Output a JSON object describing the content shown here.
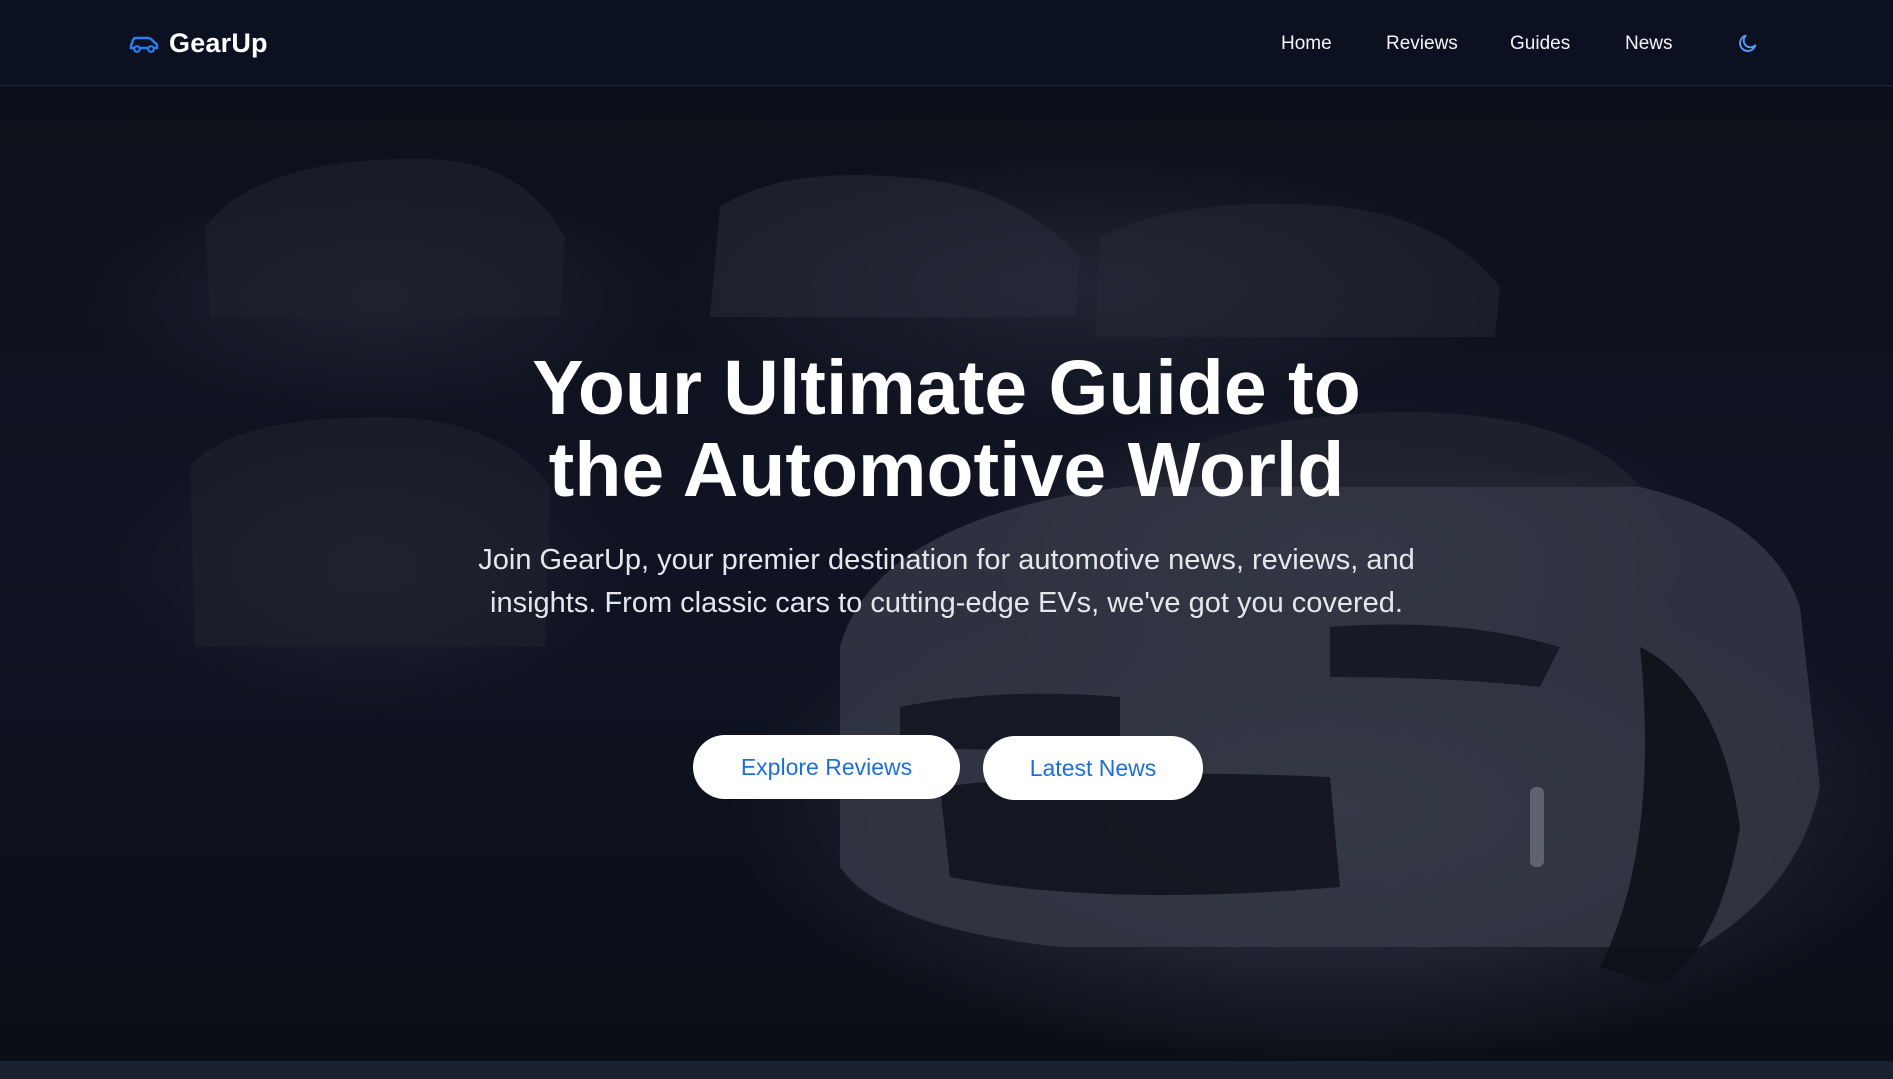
{
  "brand": {
    "name": "GearUp",
    "icon": "car-icon",
    "accent_color": "#2f7df6"
  },
  "nav": {
    "items": [
      {
        "label": "Home"
      },
      {
        "label": "Reviews"
      },
      {
        "label": "Guides"
      },
      {
        "label": "News"
      }
    ],
    "theme_toggle_icon": "moon-icon"
  },
  "hero": {
    "title_line1": "Your Ultimate Guide to",
    "title_line2": "the Automotive World",
    "subtitle": "Join GearUp, your premier destination for automotive news, reviews, and insights. From classic cars to cutting-edge EVs, we've got you covered.",
    "primary_button": "Explore Reviews",
    "secondary_button": "Latest News",
    "button_text_color": "#1d6fd6"
  }
}
